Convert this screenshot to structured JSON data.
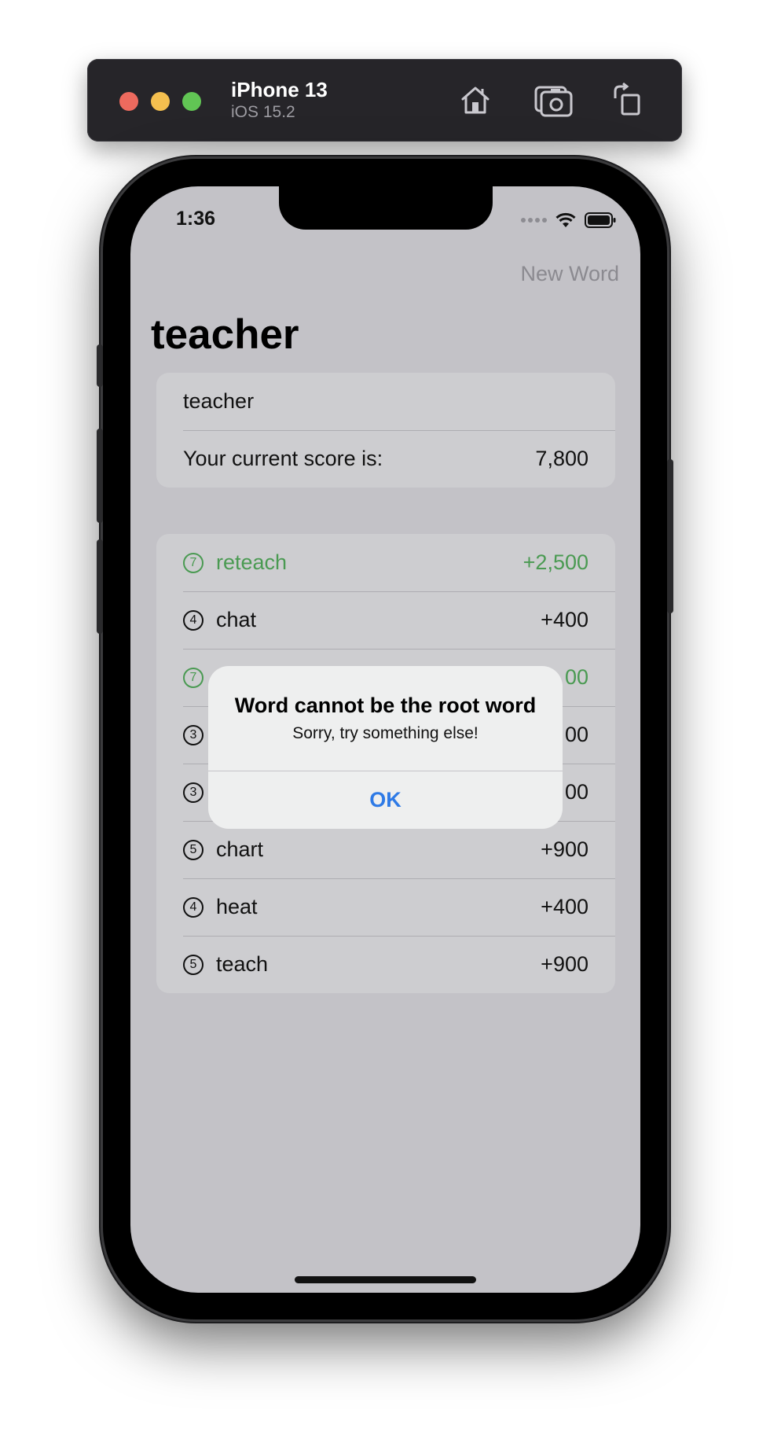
{
  "simulator": {
    "device_name": "iPhone 13",
    "os_version": "iOS 15.2",
    "icons": [
      "home-icon",
      "screenshot-icon",
      "rotate-icon"
    ]
  },
  "status_bar": {
    "time": "1:36",
    "icons": [
      "signal-dots-icon",
      "wifi-icon",
      "battery-icon"
    ]
  },
  "nav": {
    "right_button": "New Word",
    "title": "teacher"
  },
  "input_section": {
    "text_field_value": "teacher",
    "score_label": "Your current score is:",
    "score_value": "7,800"
  },
  "words": [
    {
      "length": "7",
      "word": "reteach",
      "points": "+2,500",
      "highlight": true
    },
    {
      "length": "4",
      "word": "chat",
      "points": "+400",
      "highlight": false
    },
    {
      "length": "7",
      "word": "",
      "points": "00",
      "highlight": true
    },
    {
      "length": "3",
      "word": "",
      "points": "00",
      "highlight": false
    },
    {
      "length": "3",
      "word": "",
      "points": "00",
      "highlight": false
    },
    {
      "length": "5",
      "word": "chart",
      "points": "+900",
      "highlight": false
    },
    {
      "length": "4",
      "word": "heat",
      "points": "+400",
      "highlight": false
    },
    {
      "length": "5",
      "word": "teach",
      "points": "+900",
      "highlight": false
    }
  ],
  "alert": {
    "title": "Word cannot be the root word",
    "message": "Sorry, try something else!",
    "button": "OK"
  },
  "colors": {
    "accent_green": "#4a9a52",
    "alert_button_blue": "#2e7ae6"
  }
}
